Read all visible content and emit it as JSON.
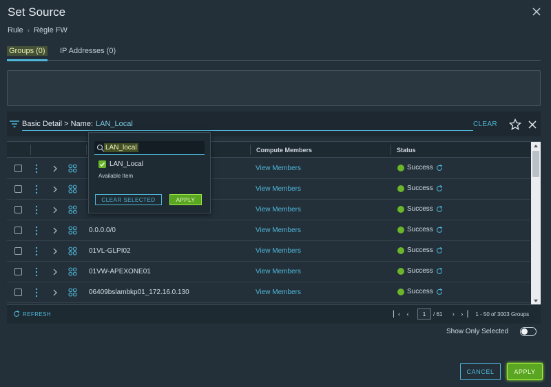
{
  "dialog": {
    "title": "Set Source",
    "breadcrumb": [
      "Rule",
      "Règle FW"
    ]
  },
  "tabs": [
    {
      "label": "Groups (0)",
      "active": true
    },
    {
      "label": "IP Addresses (0)",
      "active": false
    }
  ],
  "filter": {
    "prefix": "Basic Detail > Name:",
    "value": "LAN_Local",
    "clear_label": "CLEAR"
  },
  "popup": {
    "search_value": "LAN_local",
    "item": "LAN_Local",
    "hint": "Available Item",
    "clear_selected_label": "CLEAR SELECTED",
    "apply_label": "APPLY"
  },
  "grid": {
    "columns": [
      "Compute Members",
      "Status"
    ],
    "rows": [
      {
        "name": "",
        "members": "View Members",
        "status": "Success"
      },
      {
        "name": "",
        "members": "View Members",
        "status": "Success"
      },
      {
        "name": "",
        "members": "View Members",
        "status": "Success"
      },
      {
        "name": "0.0.0.0/0",
        "members": "View Members",
        "status": "Success"
      },
      {
        "name": "01VL-GLPI02",
        "members": "View Members",
        "status": "Success"
      },
      {
        "name": "01VW-APEXONE01",
        "members": "View Members",
        "status": "Success"
      },
      {
        "name": "06409bslambkp01_172.16.0.130",
        "members": "View Members",
        "status": "Success"
      }
    ]
  },
  "footer": {
    "refresh_label": "REFRESH",
    "page": "1",
    "of_pages": "/ 61",
    "range": "1 - 50 of 3003 Groups"
  },
  "show_only_selected": "Show Only Selected",
  "actions": {
    "cancel": "CANCEL",
    "apply": "APPLY"
  },
  "colors": {
    "accent": "#4fb7d8",
    "success": "#6ab52a",
    "background": "#23303a"
  }
}
